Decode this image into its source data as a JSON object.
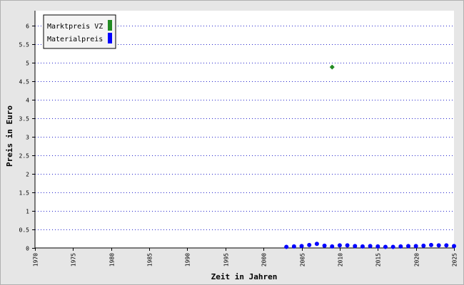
{
  "chart_data": {
    "type": "scatter",
    "xlabel": "Zeit in Jahren",
    "ylabel": "Preis in Euro",
    "xlim": [
      1970,
      2025
    ],
    "ylim": [
      0,
      6.4
    ],
    "x_ticks": [
      "1970",
      "1975",
      "1980",
      "1985",
      "1990",
      "1995",
      "2000",
      "2005",
      "2010",
      "2015",
      "2020",
      "2025"
    ],
    "y_ticks": [
      "0",
      "0.5",
      "1",
      "1.5",
      "2",
      "2.5",
      "3",
      "3.5",
      "4",
      "4.5",
      "5",
      "5.5",
      "6"
    ],
    "grid": true,
    "legend_position": "top-left",
    "series": [
      {
        "name": "Marktpreis VZ",
        "color": "#228b22",
        "marker": "diamond",
        "points": [
          {
            "x": 2009,
            "y": 4.88
          }
        ]
      },
      {
        "name": "Materialpreis",
        "color": "#0000ff",
        "marker": "circle",
        "points": [
          {
            "x": 2003,
            "y": 0.03
          },
          {
            "x": 2004,
            "y": 0.04
          },
          {
            "x": 2005,
            "y": 0.05
          },
          {
            "x": 2006,
            "y": 0.08
          },
          {
            "x": 2007,
            "y": 0.11
          },
          {
            "x": 2008,
            "y": 0.06
          },
          {
            "x": 2009,
            "y": 0.04
          },
          {
            "x": 2010,
            "y": 0.07
          },
          {
            "x": 2011,
            "y": 0.07
          },
          {
            "x": 2012,
            "y": 0.05
          },
          {
            "x": 2013,
            "y": 0.04
          },
          {
            "x": 2014,
            "y": 0.05
          },
          {
            "x": 2015,
            "y": 0.04
          },
          {
            "x": 2016,
            "y": 0.03
          },
          {
            "x": 2017,
            "y": 0.03
          },
          {
            "x": 2018,
            "y": 0.04
          },
          {
            "x": 2019,
            "y": 0.05
          },
          {
            "x": 2020,
            "y": 0.05
          },
          {
            "x": 2021,
            "y": 0.06
          },
          {
            "x": 2022,
            "y": 0.08
          },
          {
            "x": 2023,
            "y": 0.07
          },
          {
            "x": 2024,
            "y": 0.07
          },
          {
            "x": 2025,
            "y": 0.05
          }
        ]
      }
    ]
  }
}
